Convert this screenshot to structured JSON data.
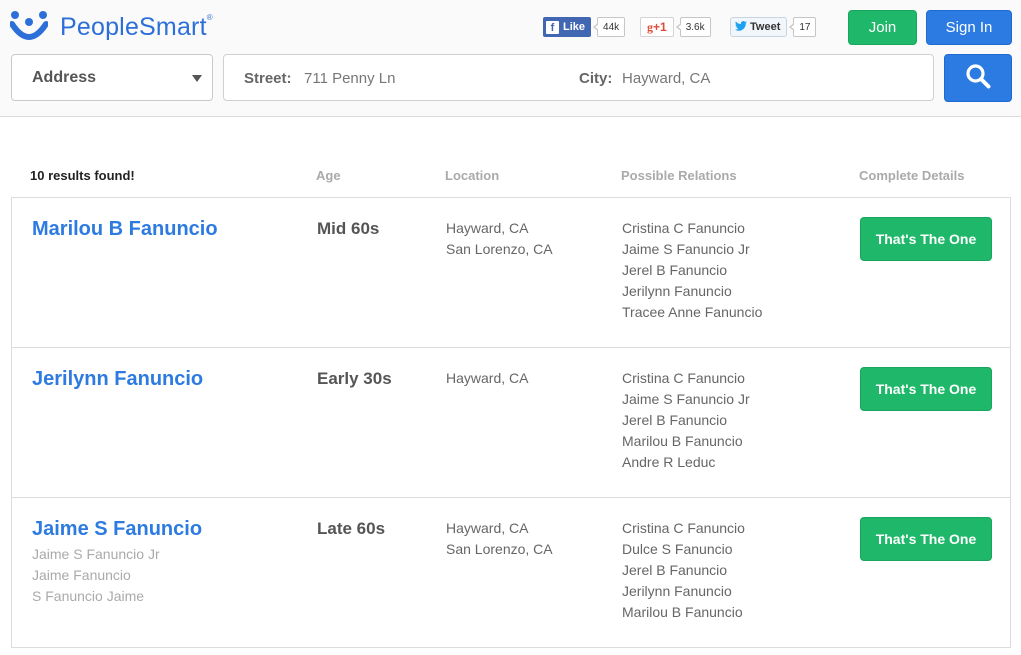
{
  "brand": {
    "name": "PeopleSmart",
    "tm": "®",
    "color": "#2d6fd8"
  },
  "social": {
    "facebook": {
      "label": "Like",
      "count": "44k"
    },
    "gplus": {
      "label": "+1",
      "count": "3.6k"
    },
    "twitter": {
      "label": "Tweet",
      "count": "17"
    }
  },
  "header": {
    "join_label": "Join",
    "signin_label": "Sign In"
  },
  "search": {
    "type": "Address",
    "street_label": "Street:",
    "street_value": "711 Penny Ln",
    "city_label": "City:",
    "city_value": "Hayward, CA",
    "button_icon": "search-icon"
  },
  "results": {
    "count_text": "10 results found!",
    "columns": {
      "age": "Age",
      "location": "Location",
      "relations": "Possible Relations",
      "details": "Complete Details"
    },
    "rows": [
      {
        "name": "Marilou B Fanuncio",
        "aka": [],
        "age": "Mid 60s",
        "locations": [
          "Hayward, CA",
          "San Lorenzo, CA"
        ],
        "relations": [
          "Cristina C Fanuncio",
          "Jaime S Fanuncio Jr",
          "Jerel B Fanuncio",
          "Jerilynn Fanuncio",
          "Tracee Anne Fanuncio"
        ],
        "button": "That's The One"
      },
      {
        "name": "Jerilynn Fanuncio",
        "aka": [],
        "age": "Early 30s",
        "locations": [
          "Hayward, CA"
        ],
        "relations": [
          "Cristina C Fanuncio",
          "Jaime S Fanuncio Jr",
          "Jerel B Fanuncio",
          "Marilou B Fanuncio",
          "Andre R Leduc"
        ],
        "button": "That's The One"
      },
      {
        "name": "Jaime S Fanuncio",
        "aka": [
          "Jaime S Fanuncio Jr",
          "Jaime Fanuncio",
          "S Fanuncio Jaime"
        ],
        "age": "Late 60s",
        "locations": [
          "Hayward, CA",
          "San Lorenzo, CA"
        ],
        "relations": [
          "Cristina C Fanuncio",
          "Dulce S Fanuncio",
          "Jerel B Fanuncio",
          "Jerilynn Fanuncio",
          "Marilou B Fanuncio"
        ],
        "button": "That's The One"
      }
    ]
  },
  "colors": {
    "green": "#1fb86a",
    "blue": "#2b7be3",
    "link": "#2d7be0"
  }
}
